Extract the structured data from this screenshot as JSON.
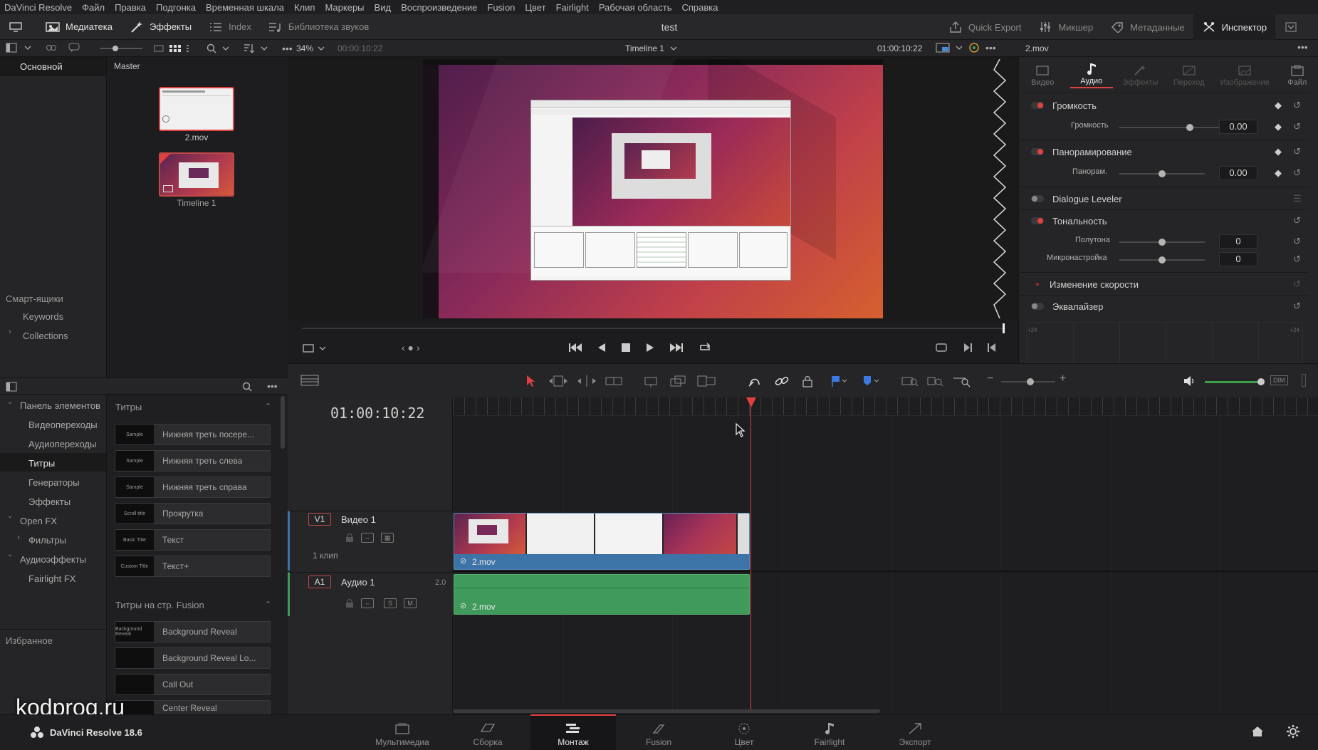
{
  "menu": [
    "DaVinci Resolve",
    "Файл",
    "Правка",
    "Подгонка",
    "Временная шкала",
    "Клип",
    "Маркеры",
    "Вид",
    "Воспроизведение",
    "Fusion",
    "Цвет",
    "Fairlight",
    "Рабочая область",
    "Справка"
  ],
  "toolbar": {
    "media_pool": "Медиатека",
    "effects": "Эффекты",
    "index": "Index",
    "sound_library": "Библиотека звуков",
    "project_title": "test",
    "quick_export": "Quick Export",
    "mixer": "Микшер",
    "metadata": "Метаданные",
    "inspector": "Инспектор"
  },
  "viewer_bar": {
    "zoom": "34%",
    "source_tc": "00:00:10:22",
    "timeline_name": "Timeline 1",
    "timecode": "01:00:10:22",
    "clip_name": "2.mov"
  },
  "media_pool": {
    "bins": [
      "Основной"
    ],
    "bin_header": "Master",
    "clips": [
      {
        "name": "2.mov"
      },
      {
        "name": "Timeline 1"
      }
    ],
    "smart_bins_title": "Смарт-ящики",
    "smart_bins": [
      "Keywords",
      "Collections"
    ]
  },
  "effects": {
    "tree": [
      {
        "label": "Панель элементов",
        "level": 0,
        "expanded": true
      },
      {
        "label": "Видеопереходы",
        "level": 1
      },
      {
        "label": "Аудиопереходы",
        "level": 1
      },
      {
        "label": "Титры",
        "level": 1,
        "active": true
      },
      {
        "label": "Генераторы",
        "level": 1
      },
      {
        "label": "Эффекты",
        "level": 1
      },
      {
        "label": "Open FX",
        "level": 0,
        "expanded": true
      },
      {
        "label": "Фильтры",
        "level": 1,
        "collapsed": true
      },
      {
        "label": "Аудиоэффекты",
        "level": 0,
        "expanded": true
      },
      {
        "label": "Fairlight FX",
        "level": 1
      }
    ],
    "favorites": "Избранное",
    "titles_header": "Титры",
    "titles": [
      {
        "thumb": "Sample",
        "label": "Нижняя треть посере..."
      },
      {
        "thumb": "Sample",
        "label": "Нижняя треть слева"
      },
      {
        "thumb": "Sample",
        "label": "Нижняя треть справа"
      },
      {
        "thumb": "Scroll title",
        "label": "Прокрутка"
      },
      {
        "thumb": "Basic Title",
        "label": "Текст"
      },
      {
        "thumb": "Custom Title",
        "label": "Текст+"
      }
    ],
    "fusion_header": "Титры на стр. Fusion",
    "fusion_titles": [
      {
        "thumb": "Background Reveal",
        "label": "Background Reveal"
      },
      {
        "thumb": "",
        "label": "Background Reveal Lo..."
      },
      {
        "thumb": "",
        "label": "Call Out"
      },
      {
        "thumb": "",
        "label": "Center Reveal"
      }
    ]
  },
  "inspector": {
    "tabs": [
      "Видео",
      "Аудио",
      "Эффекты",
      "Переход",
      "Изображение",
      "Файл"
    ],
    "active_tab": "Аудио",
    "volume_section": "Громкость",
    "volume_label": "Громкость",
    "volume_value": "0.00",
    "volume_level": 0.62,
    "pan_section": "Панорамирование",
    "pan_label": "Панорам.",
    "pan_value": "0.00",
    "pan_level": 0.5,
    "dialogue_leveler": "Dialogue Leveler",
    "pitch_section": "Тональность",
    "semitones_label": "Полутона",
    "semitones_value": "0",
    "cents_label": "Микронастройка",
    "cents_value": "0",
    "speed_section": "Изменение скорости",
    "eq_section": "Эквалайзер",
    "eq_scale": "+24"
  },
  "timeline": {
    "timecode": "01:00:10:22",
    "video_track": {
      "id": "V1",
      "name": "Видео 1",
      "clips_count": "1 клип",
      "clip_name": "2.mov"
    },
    "audio_track": {
      "id": "A1",
      "name": "Аудио 1",
      "channels": "2.0",
      "clip_name": "2.mov",
      "solo": "S",
      "mute": "M"
    },
    "dim": "DIM"
  },
  "watermark": "kodprog.ru",
  "app_brand": "DaVinci Resolve 18.6",
  "pages": [
    "Мультимедиа",
    "Сборка",
    "Монтаж",
    "Fusion",
    "Цвет",
    "Fairlight",
    "Экспорт"
  ],
  "active_page": "Монтаж",
  "colors": {
    "accent_red": "#e04040",
    "video_clip": "#3d74a8",
    "audio_clip": "#3f9a5c"
  }
}
